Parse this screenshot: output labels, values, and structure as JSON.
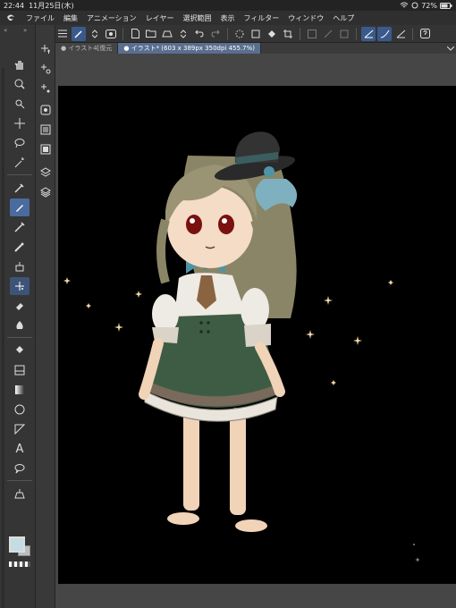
{
  "status": {
    "time": "22:44",
    "date": "11月25日(木)",
    "battery": "72%"
  },
  "menu": {
    "items": [
      "ファイル",
      "編集",
      "アニメーション",
      "レイヤー",
      "選択範囲",
      "表示",
      "フィルター",
      "ウィンドウ",
      "ヘルプ"
    ]
  },
  "tabs": [
    {
      "label": "● イラスト4[復元"
    },
    {
      "label": "● イラスト* (603 x 389px 350dpi 455.7%)"
    }
  ],
  "colors": {
    "accent": "#4a6b9d",
    "canvas": "#000000",
    "main_color": "#c4dce3"
  },
  "icons": {
    "app_logo": "clip-studio-logo",
    "wifi": "wifi-icon",
    "battery": "battery-icon"
  }
}
